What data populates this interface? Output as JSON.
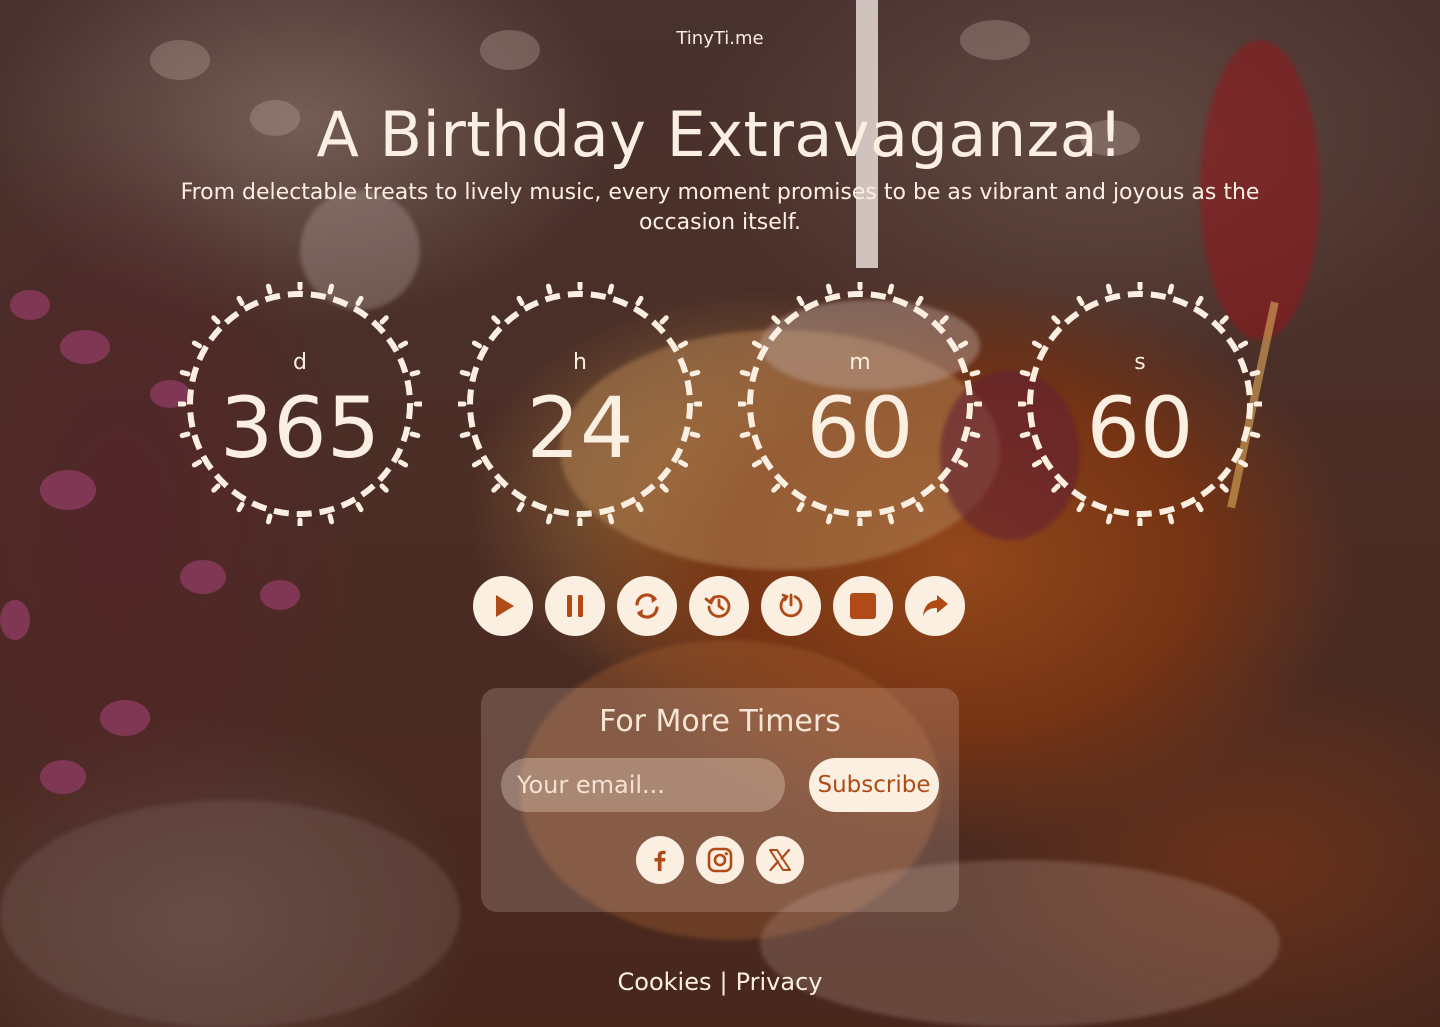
{
  "brand": "TinyTi.me",
  "title": "A Birthday Extravaganza!",
  "subtitle": "From delectable treats to lively music, every moment promises to be as vibrant and joyous as the occasion itself.",
  "timer": {
    "days": {
      "label": "d",
      "value": "365"
    },
    "hours": {
      "label": "h",
      "value": "24"
    },
    "minutes": {
      "label": "m",
      "value": "60"
    },
    "seconds": {
      "label": "s",
      "value": "60"
    }
  },
  "controls": [
    {
      "name": "play",
      "icon": "play-icon"
    },
    {
      "name": "pause",
      "icon": "pause-icon"
    },
    {
      "name": "restart",
      "icon": "refresh-icon"
    },
    {
      "name": "history",
      "icon": "history-icon"
    },
    {
      "name": "reset",
      "icon": "timer-reset-icon"
    },
    {
      "name": "stop",
      "icon": "stop-icon"
    },
    {
      "name": "share",
      "icon": "share-icon"
    }
  ],
  "newsletter": {
    "heading": "For More Timers",
    "email_placeholder": "Your email...",
    "subscribe_label": "Subscribe"
  },
  "social": [
    {
      "name": "facebook",
      "icon": "facebook-icon"
    },
    {
      "name": "instagram",
      "icon": "instagram-icon"
    },
    {
      "name": "x",
      "icon": "x-icon"
    }
  ],
  "footer": {
    "cookies": "Cookies",
    "separator": "|",
    "privacy": "Privacy"
  },
  "colors": {
    "accent": "#b04a16",
    "cream": "#fbefe2"
  }
}
